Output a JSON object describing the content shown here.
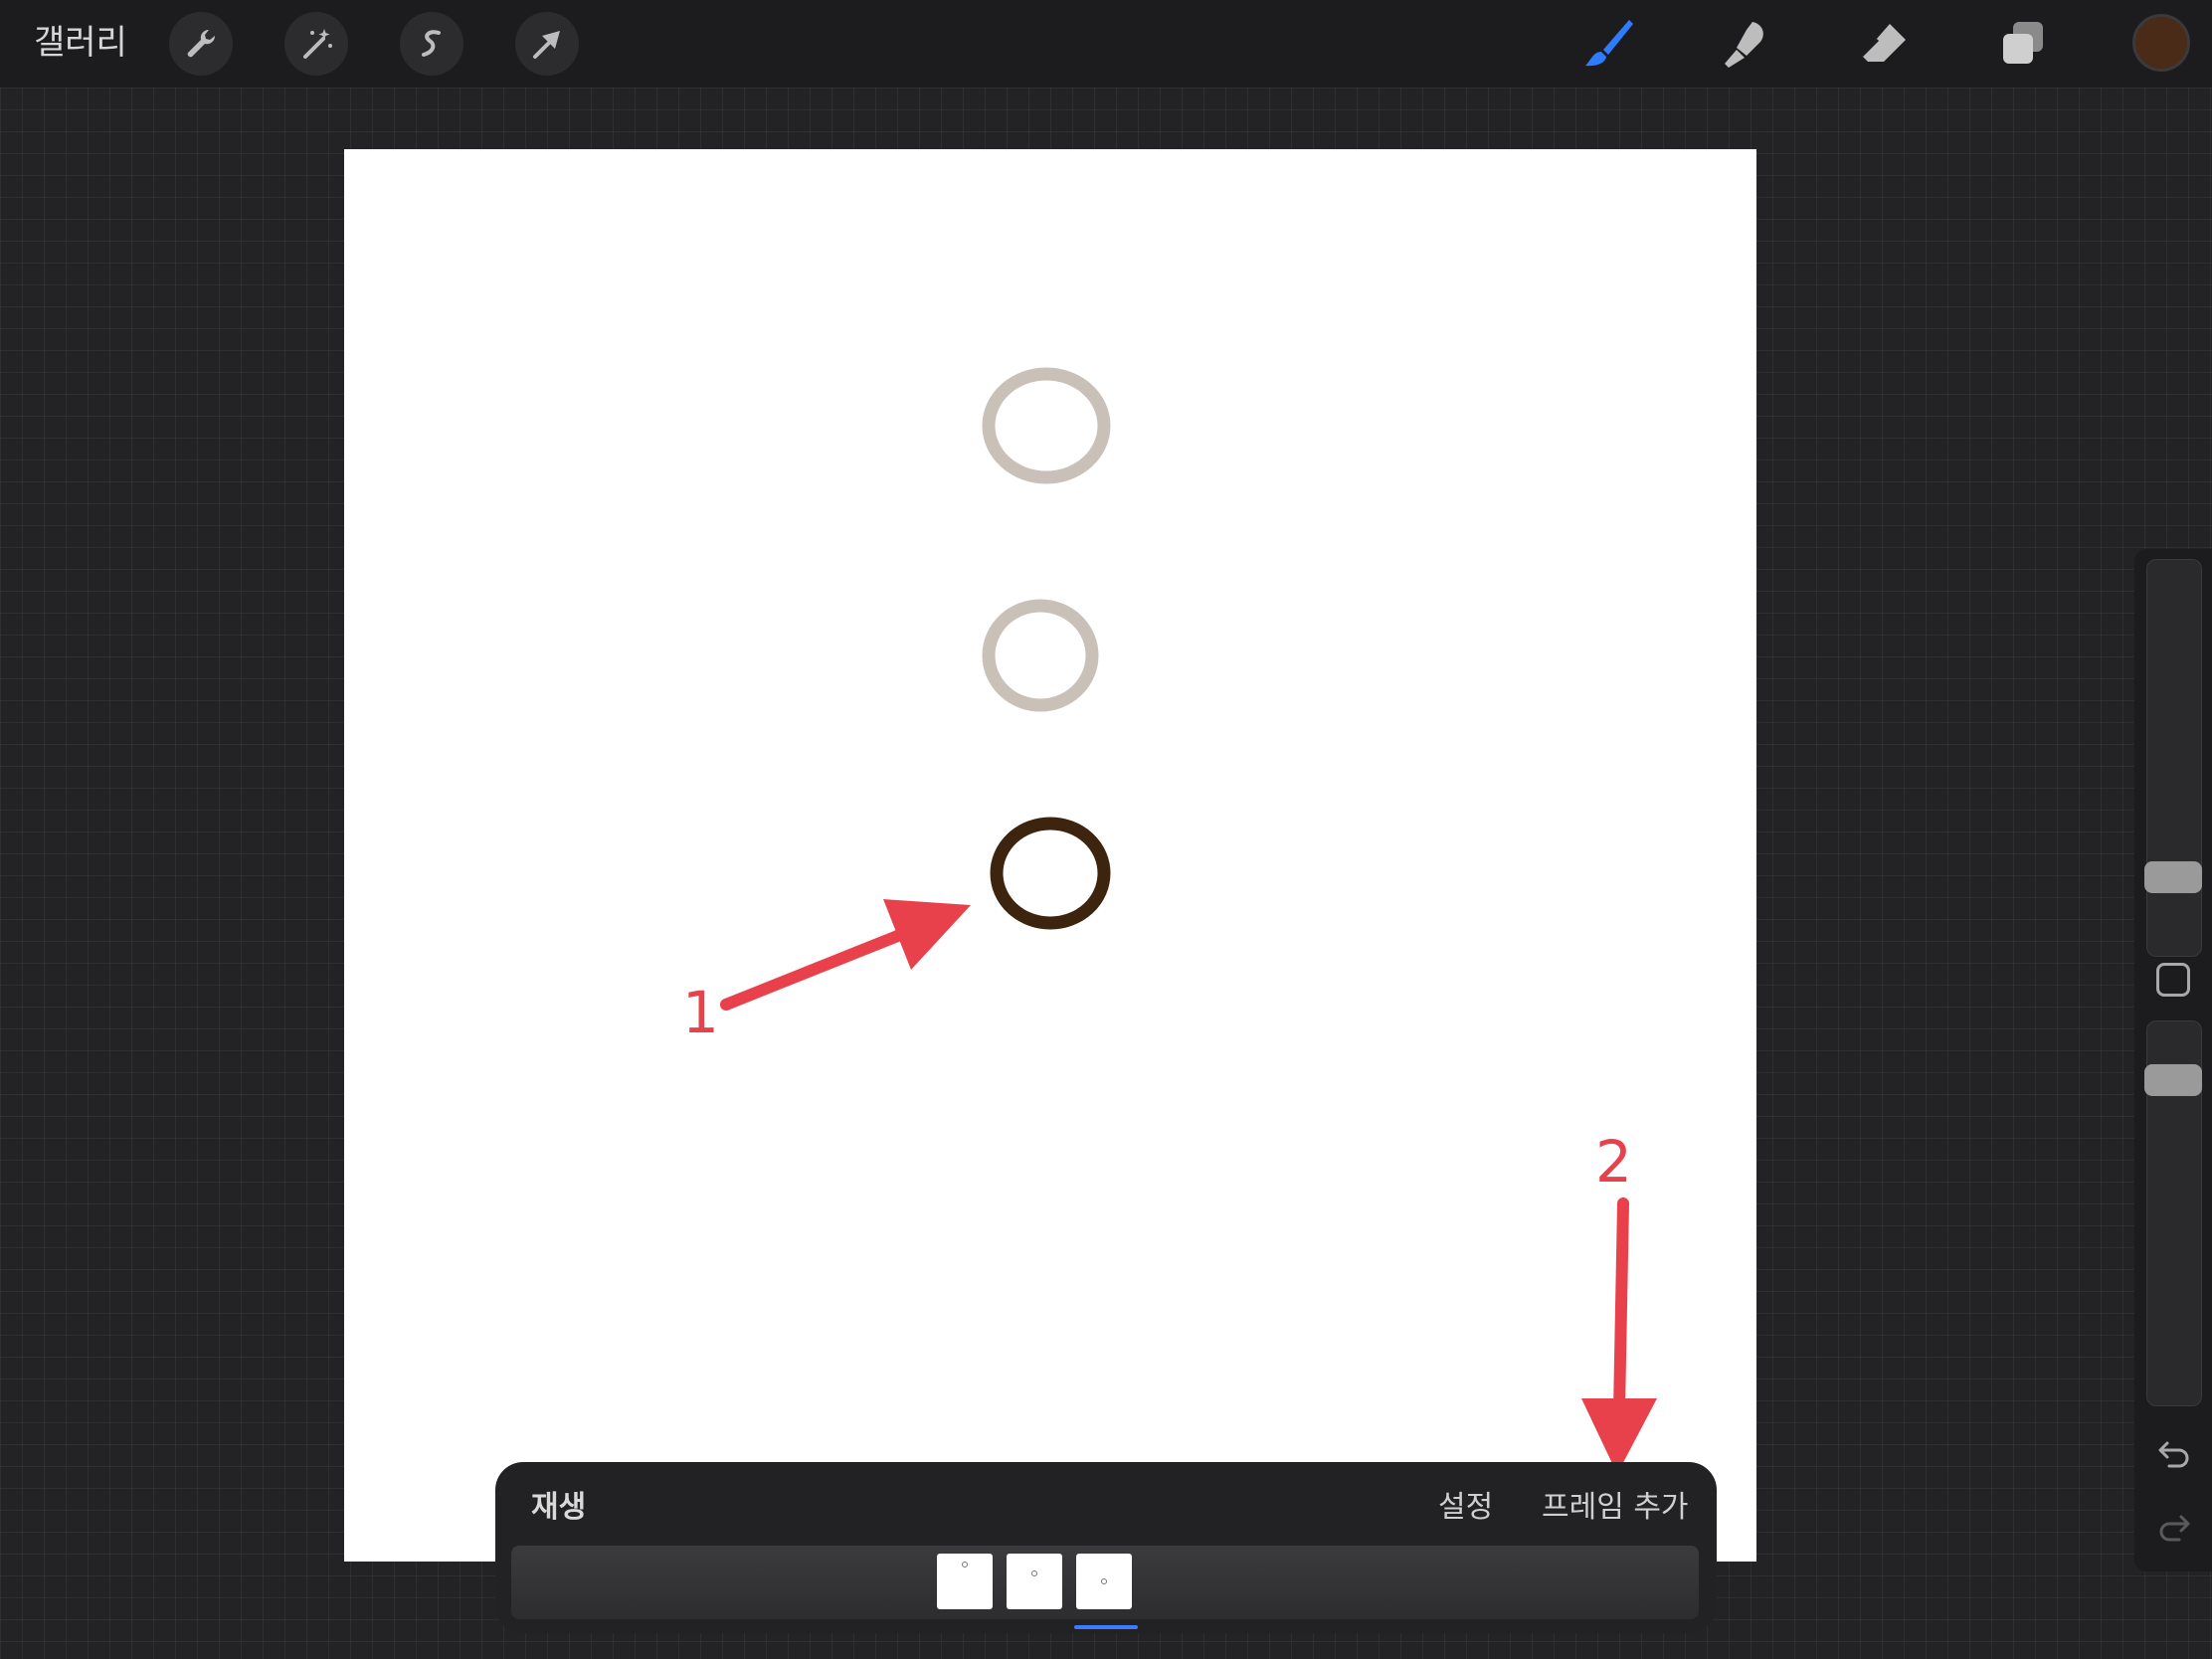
{
  "toolbar": {
    "gallery_label": "갤러리",
    "left_tools": [
      {
        "name": "wrench-icon"
      },
      {
        "name": "magic-wand-icon"
      },
      {
        "name": "selection-icon"
      },
      {
        "name": "transform-arrow-icon"
      }
    ],
    "right_tools": [
      {
        "name": "brush-icon",
        "active": true
      },
      {
        "name": "smudge-icon"
      },
      {
        "name": "eraser-icon"
      },
      {
        "name": "layers-icon"
      }
    ],
    "current_color": "#4a2b17",
    "accent_color": "#3a7bff"
  },
  "canvas": {
    "strokes": [
      {
        "name": "onion-skin-circle-1",
        "color": "#c9c1b8"
      },
      {
        "name": "onion-skin-circle-2",
        "color": "#c9c1b8"
      },
      {
        "name": "current-frame-circle",
        "color": "#3d240f"
      }
    ]
  },
  "sidebar": {
    "size_slider_name": "brush-size-slider",
    "opacity_slider_name": "brush-opacity-slider",
    "undo_name": "undo-icon",
    "redo_name": "redo-icon"
  },
  "timeline": {
    "play_label": "재생",
    "settings_label": "설정",
    "add_frame_label": "프레임 추가",
    "frames": [
      {
        "index": 1
      },
      {
        "index": 2
      },
      {
        "index": 3,
        "selected": true
      }
    ]
  },
  "annotations": {
    "label_1": "1",
    "label_2": "2",
    "color": "#e8414b"
  }
}
